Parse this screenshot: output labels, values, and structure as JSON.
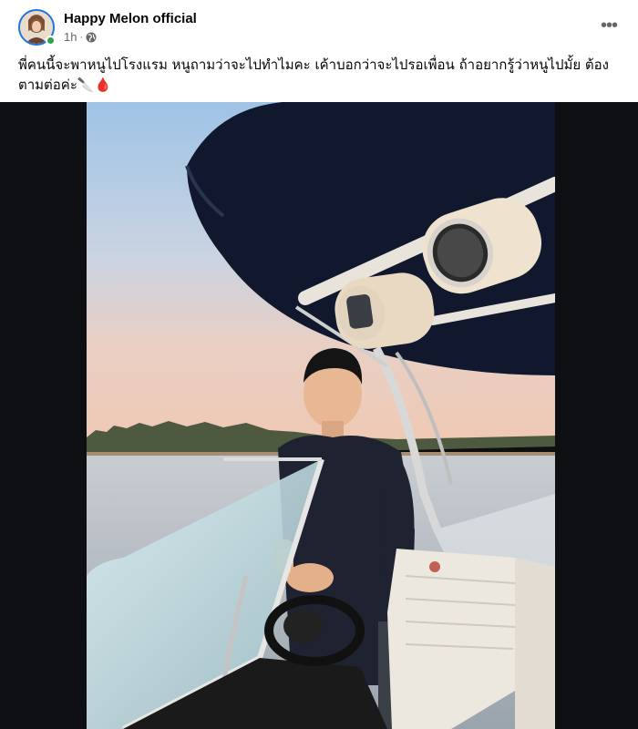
{
  "post": {
    "author": "Happy Melon official",
    "time": "1h",
    "separator": "·",
    "caption": "พี่คนนี้จะพาหนูไปโรงแรม หนูถามว่าจะไปทำไมคะ เค้าบอกว่าจะไปรอเพื่อน ถ้าอยากรู้ว่าหนูไปมั้ย ต้องตามต่อค่ะ🔪🩸",
    "more_label": "•••"
  },
  "icons": {
    "privacy": "globe-icon",
    "more": "more-options-icon",
    "online": "online-status-dot"
  },
  "colors": {
    "online": "#31a24c",
    "avatar_ring": "#1b74e4",
    "meta_text": "#65676b"
  }
}
